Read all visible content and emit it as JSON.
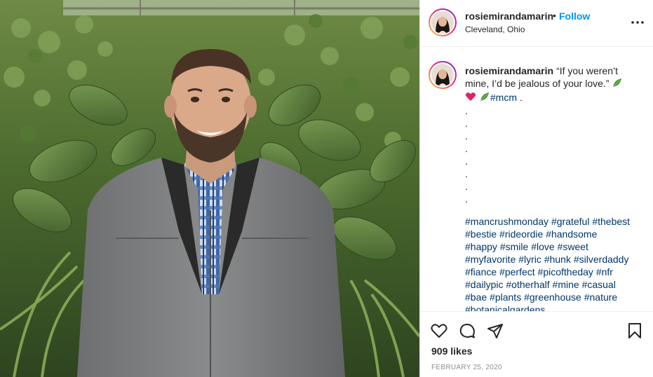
{
  "post": {
    "username": "rosiemirandamarin",
    "separator": "•",
    "follow_label": "Follow",
    "location": "Cleveland, Ohio",
    "caption": {
      "username": "rosiemirandamarin",
      "text_line1": "“If you weren’t",
      "text_line2": "mine, I’d be jealous of your love.”",
      "inline_tag": "#mcm",
      "trailing": " ."
    },
    "dots": [
      ".",
      ".",
      ".",
      ".",
      ".",
      ".",
      ".",
      "."
    ],
    "hashtag_rows": [
      [
        "#mancrushmonday",
        "#grateful",
        "#thebest"
      ],
      [
        "#bestie",
        "#rideordie",
        "#handsome"
      ],
      [
        "#happy",
        "#smile",
        "#love",
        "#sweet"
      ],
      [
        "#myfavorite",
        "#lyric",
        "#hunk",
        "#silverdaddy"
      ],
      [
        "#fiance",
        "#perfect",
        "#picoftheday",
        "#nfr"
      ],
      [
        "#dailypic",
        "#otherhalf",
        "#mine",
        "#casual"
      ],
      [
        "#bae",
        "#plants",
        "#greenhouse",
        "#nature"
      ],
      [
        "#botanicalgardens"
      ]
    ],
    "likes": "909 likes",
    "date": "FEBRUARY 25, 2020"
  },
  "icons": {
    "more": "more-options-icon",
    "like": "heart-icon",
    "comment": "comment-icon",
    "share": "share-icon",
    "save": "bookmark-icon",
    "leaf": "herb-emoji",
    "heart_emoji": "red-heart-emoji"
  },
  "colors": {
    "link_blue": "#0095f6",
    "hashtag": "#00376b",
    "text": "#262626",
    "muted": "#8e8e8e",
    "border": "#efefef"
  }
}
